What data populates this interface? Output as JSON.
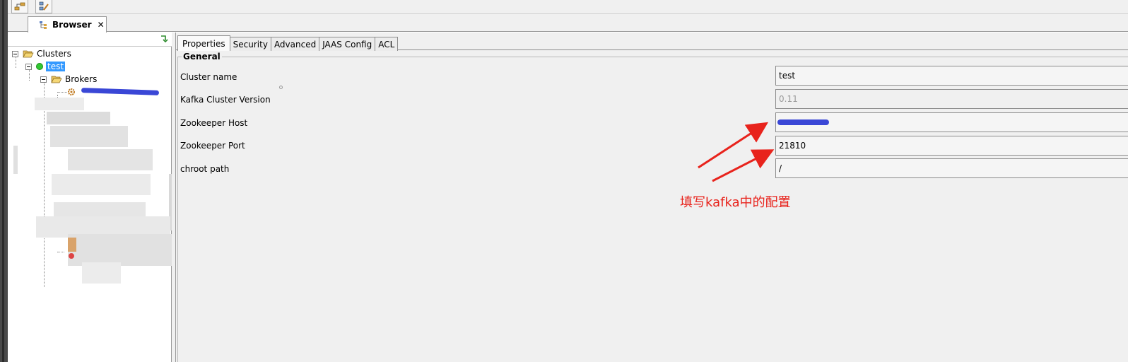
{
  "window": {
    "tab_label": "Browser",
    "tab_close": "✕"
  },
  "toolbar": {
    "buttons": [
      "connect-icon",
      "edit-icon"
    ]
  },
  "tree": {
    "root_label": "Clusters",
    "cluster_label": "test",
    "brokers_label": "Brokers"
  },
  "subtabs": [
    "Properties",
    "Security",
    "Advanced",
    "JAAS Config",
    "ACL"
  ],
  "general": {
    "title": "General",
    "fields": [
      {
        "label": "Cluster name",
        "value": "test",
        "disabled": false
      },
      {
        "label": "Kafka Cluster Version",
        "value": "0.11",
        "disabled": true
      },
      {
        "label": "Zookeeper Host",
        "value": "",
        "disabled": false
      },
      {
        "label": "Zookeeper Port",
        "value": "21810",
        "disabled": false
      },
      {
        "label": "chroot path",
        "value": "/",
        "disabled": false
      }
    ]
  },
  "annotation": {
    "text": "填写kafka中的配置",
    "color": "#e8231c"
  },
  "colors": {
    "selection": "#3399ff",
    "status_online": "#32c832",
    "redaction": "#3a47d6"
  }
}
